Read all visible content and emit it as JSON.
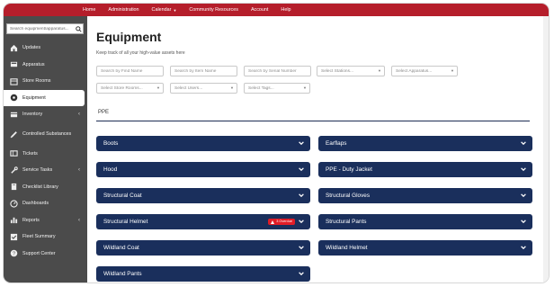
{
  "topnav": {
    "items": [
      "Home",
      "Administration",
      "Calendar",
      "Community Resources",
      "Account",
      "Help"
    ],
    "dropdown_item": "Calendar"
  },
  "sidebar": {
    "search_placeholder": "Search equipment/apparatus...",
    "items": [
      {
        "label": "Updates",
        "icon": "home-icon"
      },
      {
        "label": "Apparatus",
        "icon": "truck-icon"
      },
      {
        "label": "Store Rooms",
        "icon": "store-icon"
      },
      {
        "label": "Equipment",
        "icon": "gear-icon",
        "active": true
      },
      {
        "label": "Inventory",
        "icon": "box-icon",
        "chevron": true
      },
      {
        "label": "Controlled Substances",
        "icon": "syringe-icon"
      },
      {
        "label": "Tickets",
        "icon": "ticket-icon"
      },
      {
        "label": "Service Tasks",
        "icon": "wrench-icon",
        "chevron": true
      },
      {
        "label": "Checklist Library",
        "icon": "book-icon"
      },
      {
        "label": "Dashboards",
        "icon": "dashboard-icon"
      },
      {
        "label": "Reports",
        "icon": "bar-chart-icon",
        "chevron": true
      },
      {
        "label": "Fleet Summary",
        "icon": "check-square-icon"
      },
      {
        "label": "Support Center",
        "icon": "question-icon"
      }
    ]
  },
  "page": {
    "title": "Equipment",
    "subtitle": "Keep track of all your high-value assets here",
    "section": "PPE"
  },
  "filters": {
    "find_name": "Search by Find Name",
    "item_name": "Search by Item Name",
    "serial_number": "Search by Serial Number",
    "stations": "Select Stations...",
    "apparatus": "Select Apparatus...",
    "store_rooms": "Select Store Rooms...",
    "users": "Select Users...",
    "tags": "Select Tags..."
  },
  "equipment_items": [
    {
      "name": "Boots"
    },
    {
      "name": "Earflaps"
    },
    {
      "name": "Hood"
    },
    {
      "name": "PPE - Duty Jacket"
    },
    {
      "name": "Structural Coat"
    },
    {
      "name": "Structural Gloves"
    },
    {
      "name": "Structural Helmet",
      "badge": "3 Overdue"
    },
    {
      "name": "Structural Pants"
    },
    {
      "name": "Wildland Coat"
    },
    {
      "name": "Wildland Helmet"
    },
    {
      "name": "Wildland Pants"
    }
  ],
  "colors": {
    "topbar": "#b51e2b",
    "sidebar": "#4b4b4b",
    "accordion": "#1a2f5c",
    "badge": "#e11d27"
  }
}
